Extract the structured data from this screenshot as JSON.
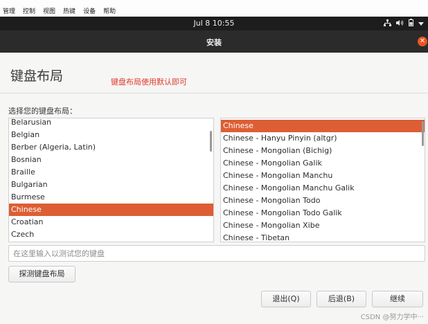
{
  "vm_menu": [
    "管理",
    "控制",
    "视图",
    "热键",
    "设备",
    "帮助"
  ],
  "top_panel": {
    "clock": "Jul 8  10:55",
    "tray_icons": [
      "network-icon",
      "volume-icon",
      "battery-icon",
      "system-menu-icon"
    ]
  },
  "window": {
    "title": "安装"
  },
  "page": {
    "heading": "键盘布局",
    "annotation": "键盘布局使用默认即可",
    "prompt": "选择您的键盘布局："
  },
  "layouts": [
    {
      "label": "Belarusian",
      "selected": false
    },
    {
      "label": "Belgian",
      "selected": false
    },
    {
      "label": "Berber (Algeria, Latin)",
      "selected": false
    },
    {
      "label": "Bosnian",
      "selected": false
    },
    {
      "label": "Braille",
      "selected": false
    },
    {
      "label": "Bulgarian",
      "selected": false
    },
    {
      "label": "Burmese",
      "selected": false
    },
    {
      "label": "Chinese",
      "selected": true
    },
    {
      "label": "Croatian",
      "selected": false
    },
    {
      "label": "Czech",
      "selected": false
    }
  ],
  "variants": [
    {
      "label": "Chinese",
      "selected": true
    },
    {
      "label": "Chinese - Hanyu Pinyin (altgr)",
      "selected": false
    },
    {
      "label": "Chinese - Mongolian (Bichig)",
      "selected": false
    },
    {
      "label": "Chinese - Mongolian Galik",
      "selected": false
    },
    {
      "label": "Chinese - Mongolian Manchu",
      "selected": false
    },
    {
      "label": "Chinese - Mongolian Manchu Galik",
      "selected": false
    },
    {
      "label": "Chinese - Mongolian Todo",
      "selected": false
    },
    {
      "label": "Chinese - Mongolian Todo Galik",
      "selected": false
    },
    {
      "label": "Chinese - Mongolian Xibe",
      "selected": false
    },
    {
      "label": "Chinese - Tibetan",
      "selected": false
    }
  ],
  "test_input": {
    "placeholder": "在这里输入以测试您的键盘",
    "value": ""
  },
  "buttons": {
    "detect": "探测键盘布局",
    "quit": "退出(Q)",
    "back": "后退(B)",
    "continue": "继续"
  },
  "watermark": "CSDN @努力学中···",
  "colors": {
    "selection": "#dd5e34",
    "close": "#e95420",
    "annotation": "#e0392b"
  }
}
